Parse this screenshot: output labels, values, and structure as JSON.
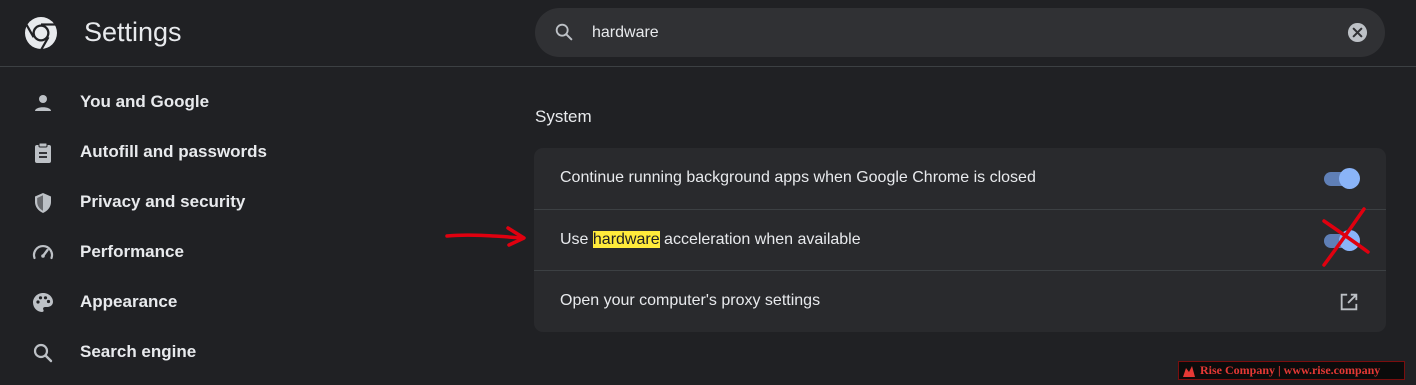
{
  "header": {
    "title": "Settings",
    "logo_icon": "chrome-logo-icon"
  },
  "search": {
    "value": "hardware",
    "search_icon": "search-icon",
    "clear_icon": "clear-icon"
  },
  "sidebar": {
    "items": [
      {
        "label": "You and Google",
        "icon": "person-icon"
      },
      {
        "label": "Autofill and passwords",
        "icon": "clipboard-icon"
      },
      {
        "label": "Privacy and security",
        "icon": "shield-icon"
      },
      {
        "label": "Performance",
        "icon": "speedometer-icon"
      },
      {
        "label": "Appearance",
        "icon": "palette-icon"
      },
      {
        "label": "Search engine",
        "icon": "search-icon"
      }
    ]
  },
  "main": {
    "section_title": "System",
    "rows": [
      {
        "label": "Continue running background apps when Google Chrome is closed",
        "control": "toggle",
        "state": "on"
      },
      {
        "label_before": "Use ",
        "label_highlight": "hardware",
        "label_after": " acceleration when available",
        "control": "toggle",
        "state": "on"
      },
      {
        "label": "Open your computer's proxy settings",
        "control": "open-in-new-icon"
      }
    ]
  },
  "annotations": {
    "arrow_icon": "red-arrow-icon",
    "cross_icon": "red-cross-icon",
    "color": "#e0000f"
  },
  "watermark": {
    "text": "Rise Company | www.rise.company",
    "logo_icon": "rise-logo-icon"
  },
  "colors": {
    "background": "#202124",
    "card": "#292a2d",
    "accent": "#8ab4f8",
    "highlight": "#ffeb3b"
  }
}
